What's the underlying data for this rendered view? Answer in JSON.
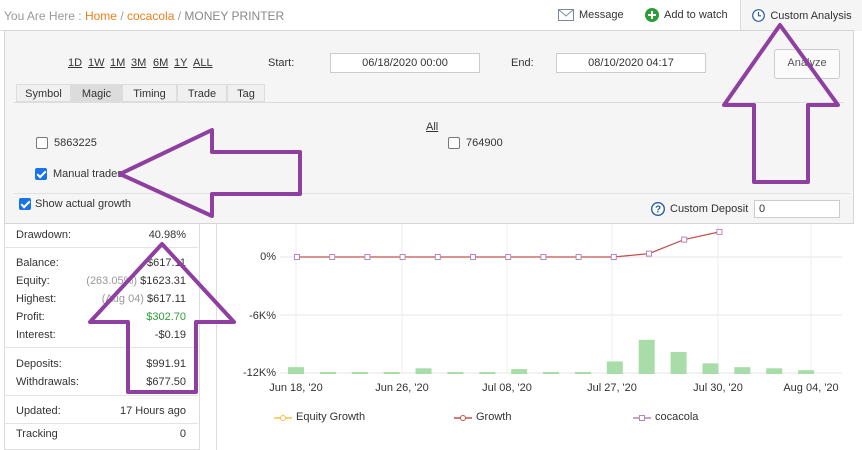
{
  "breadcrumb": {
    "prefix": "You Are Here :",
    "home": "Home",
    "sep1": "/",
    "account": "cocacola",
    "sep2": "/",
    "current": "MONEY PRINTER"
  },
  "topbar": {
    "message": "Message",
    "watch": "Add to watch",
    "custom": "Custom Analysis"
  },
  "periods": [
    "1D",
    "1W",
    "1M",
    "3M",
    "6M",
    "1Y",
    "ALL"
  ],
  "start": {
    "label": "Start:",
    "value": "06/18/2020 00:00"
  },
  "end": {
    "label": "End:",
    "value": "08/10/2020 04:17"
  },
  "analyze": "Analyze",
  "tabs": [
    "Symbol",
    "Magic",
    "Timing",
    "Trade",
    "Tag"
  ],
  "active_tab": "Magic",
  "magic": {
    "all": "All",
    "opt1": "5863225",
    "opt2": "764900",
    "manual": "Manual trades"
  },
  "show_growth": "Show actual growth",
  "custom_deposit": {
    "label": "Custom Deposit",
    "value": "0"
  },
  "stats": {
    "drawdown": {
      "k": "Drawdown:",
      "v": "40.98%"
    },
    "balance": {
      "k": "Balance:",
      "v": "$617.11"
    },
    "equity": {
      "k": "Equity:",
      "pre": "(263.05%)",
      "v": "$1623.31"
    },
    "highest": {
      "k": "Highest:",
      "pre": "(Aug 04)",
      "v": "$617.11"
    },
    "profit": {
      "k": "Profit:",
      "v": "$302.70"
    },
    "interest": {
      "k": "Interest:",
      "v": "-$0.19"
    },
    "deposits": {
      "k": "Deposits:",
      "v": "$991.91"
    },
    "withdrawals": {
      "k": "Withdrawals:",
      "v": "$677.50"
    },
    "updated": {
      "k": "Updated:",
      "v": "17 Hours ago"
    },
    "tracking": {
      "k": "Tracking",
      "v": "0"
    }
  },
  "colors": {
    "profit": "#2e9c3a",
    "accent": "#ee7d1e",
    "arrow": "#8e3fa0",
    "growth": "#c0504d",
    "bars": "#a8dca8"
  },
  "chart_data": {
    "type": "line",
    "y_ticks": [
      "0%",
      "-6K%",
      "-12K%"
    ],
    "x_ticks": [
      "Jun 18, '20",
      "Jun 26, '20",
      "Jul 08, '20",
      "Jul 27, '20",
      "Jul 30, '20",
      "Aug 04, '20"
    ],
    "legend": [
      "Equity Growth",
      "Growth",
      "cocacola"
    ],
    "growth_y": [
      0,
      0,
      0,
      0,
      0,
      0,
      0,
      0,
      0,
      0,
      350,
      1800,
      2600
    ],
    "bar_heights": [
      0.18,
      0,
      0,
      0,
      0.15,
      0,
      0,
      0.13,
      0,
      0,
      0.33,
      0.9,
      0.58,
      0.28,
      0.18,
      0.15,
      0.1
    ],
    "ylim": [
      -12000,
      0
    ]
  }
}
